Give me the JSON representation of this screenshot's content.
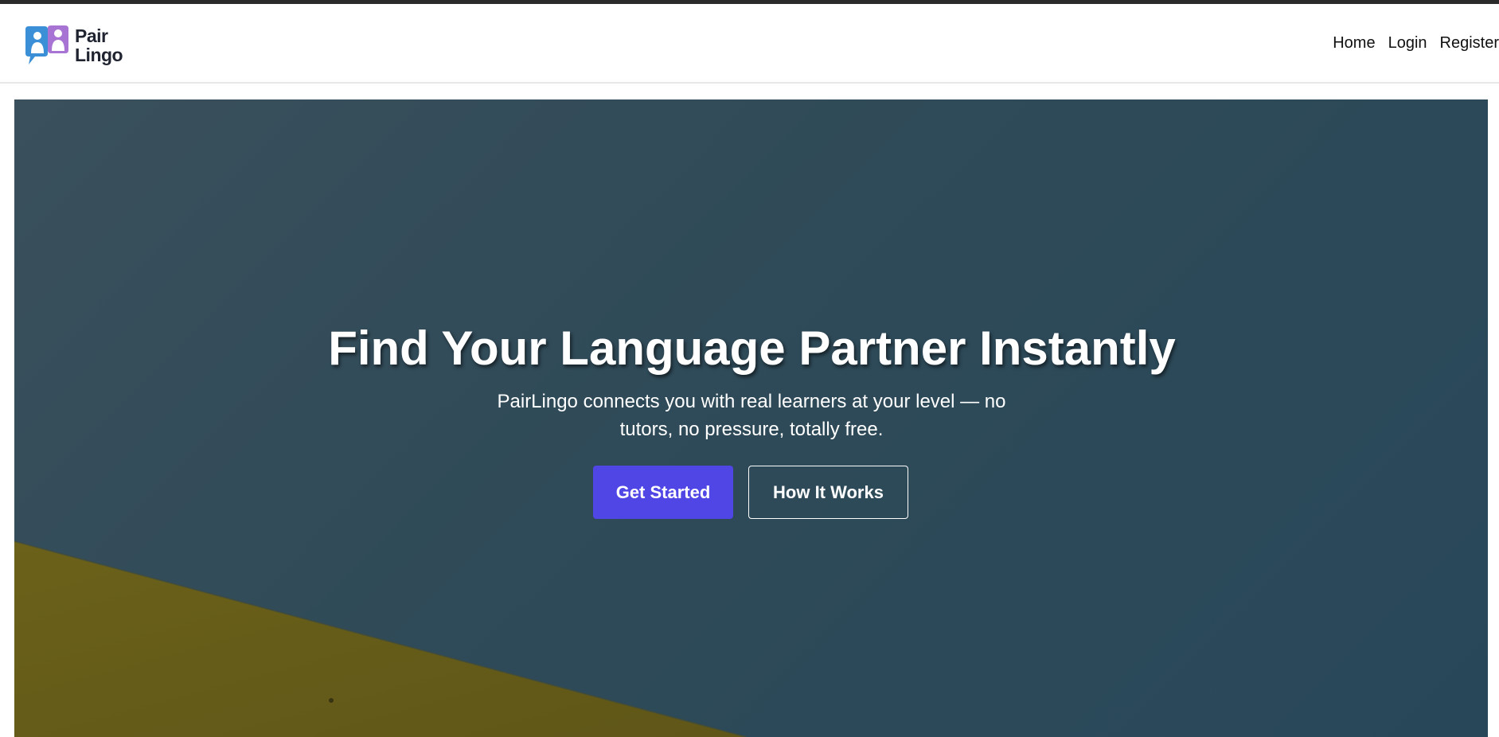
{
  "brand": {
    "name_line1": "Pair",
    "name_line2": "Lingo",
    "logo_icon": "two-people-chat-bubbles-icon",
    "colors": {
      "blue": "#3a8fd6",
      "purple": "#9b6fcb"
    }
  },
  "nav": {
    "links": [
      {
        "label": "Home"
      },
      {
        "label": "Login"
      },
      {
        "label": "Register"
      }
    ]
  },
  "hero": {
    "title": "Find Your Language Partner Instantly",
    "subtitle": "PairLingo connects you with real learners at your level — no tutors, no pressure, totally free.",
    "primary_cta": "Get Started",
    "secondary_cta": "How It Works",
    "colors": {
      "overlay": "#2f4a58",
      "accent_shape": "#6a5f1c",
      "primary_button": "#4f46e5"
    }
  }
}
